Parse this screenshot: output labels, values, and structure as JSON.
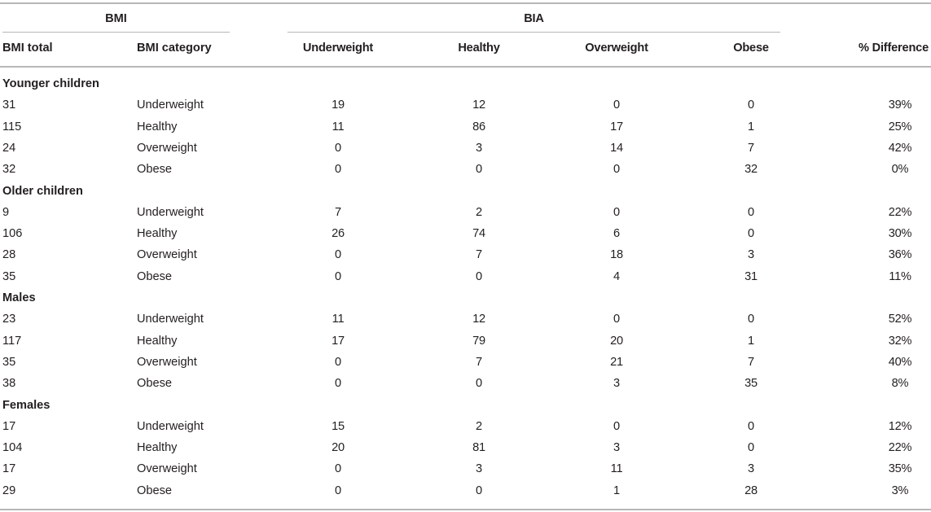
{
  "table": {
    "group_headers": {
      "bmi": "BMI",
      "bia": "BIA"
    },
    "columns": [
      "BMI total",
      "BMI category",
      "Underweight",
      "Healthy",
      "Overweight",
      "Obese",
      "% Difference"
    ],
    "sections": [
      {
        "title": "Younger children",
        "rows": [
          [
            "31",
            "Underweight",
            "19",
            "12",
            "0",
            "0",
            "39%"
          ],
          [
            "115",
            "Healthy",
            "11",
            "86",
            "17",
            "1",
            "25%"
          ],
          [
            "24",
            "Overweight",
            "0",
            "3",
            "14",
            "7",
            "42%"
          ],
          [
            "32",
            "Obese",
            "0",
            "0",
            "0",
            "32",
            "0%"
          ]
        ]
      },
      {
        "title": "Older children",
        "rows": [
          [
            "9",
            "Underweight",
            "7",
            "2",
            "0",
            "0",
            "22%"
          ],
          [
            "106",
            "Healthy",
            "26",
            "74",
            "6",
            "0",
            "30%"
          ],
          [
            "28",
            "Overweight",
            "0",
            "7",
            "18",
            "3",
            "36%"
          ],
          [
            "35",
            "Obese",
            "0",
            "0",
            "4",
            "31",
            "11%"
          ]
        ]
      },
      {
        "title": "Males",
        "rows": [
          [
            "23",
            "Underweight",
            "11",
            "12",
            "0",
            "0",
            "52%"
          ],
          [
            "117",
            "Healthy",
            "17",
            "79",
            "20",
            "1",
            "32%"
          ],
          [
            "35",
            "Overweight",
            "0",
            "7",
            "21",
            "7",
            "40%"
          ],
          [
            "38",
            "Obese",
            "0",
            "0",
            "3",
            "35",
            "8%"
          ]
        ]
      },
      {
        "title": "Females",
        "rows": [
          [
            "17",
            "Underweight",
            "15",
            "2",
            "0",
            "0",
            "12%"
          ],
          [
            "104",
            "Healthy",
            "20",
            "81",
            "3",
            "0",
            "22%"
          ],
          [
            "17",
            "Overweight",
            "0",
            "3",
            "11",
            "3",
            "35%"
          ],
          [
            "29",
            "Obese",
            "0",
            "0",
            "1",
            "28",
            "3%"
          ]
        ]
      }
    ]
  }
}
